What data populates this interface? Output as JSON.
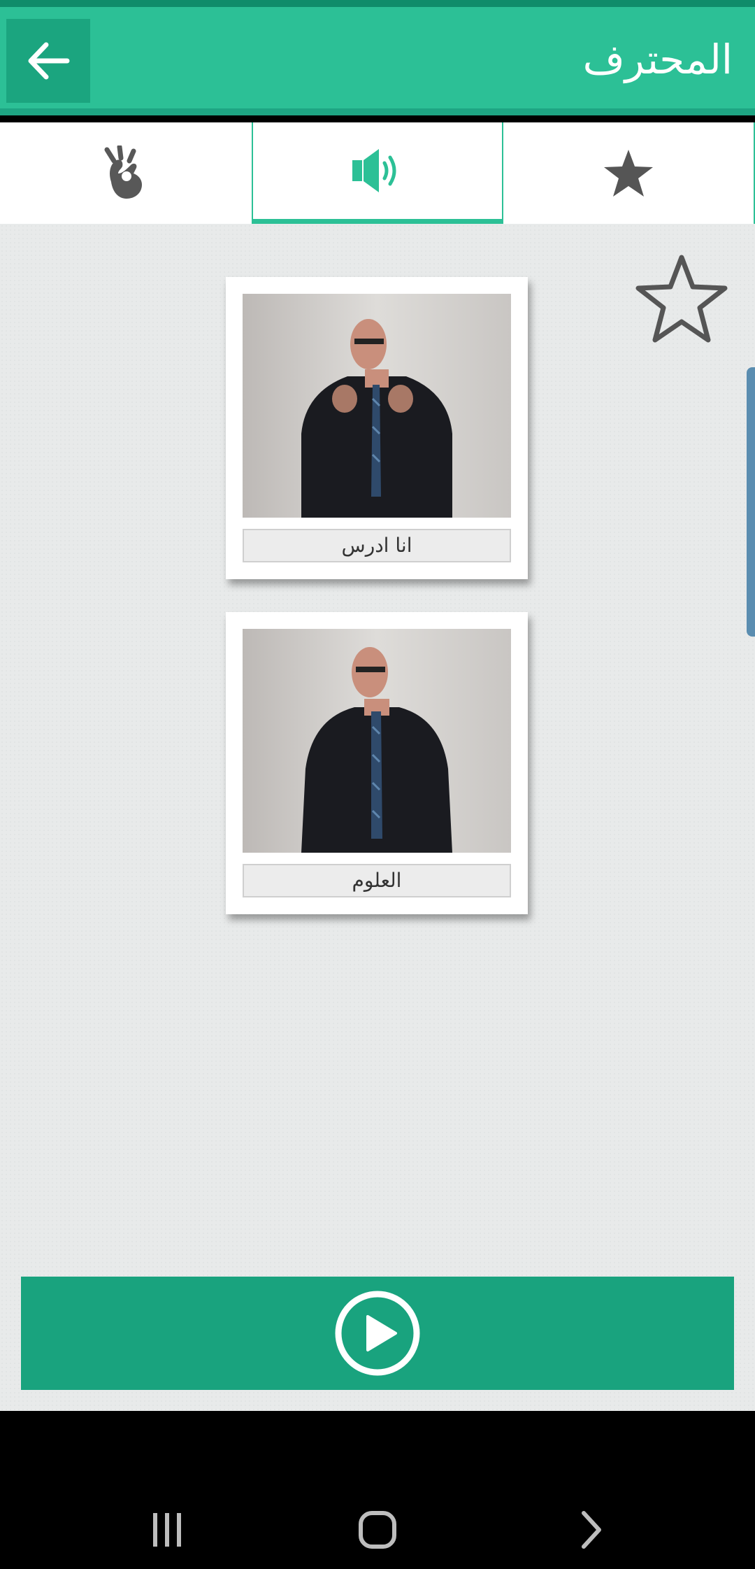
{
  "appbar": {
    "title": "المحترف",
    "back_icon": "arrow-left-icon"
  },
  "tabs": [
    {
      "icon": "hand-sign-icon",
      "selected": false
    },
    {
      "icon": "speaker-icon",
      "selected": true
    },
    {
      "icon": "star-icon",
      "selected": false
    }
  ],
  "favorite": {
    "icon": "star-outline-icon",
    "active": false
  },
  "cards": [
    {
      "caption": "انا ادرس",
      "image": "man-signing-photo"
    },
    {
      "caption": "العلوم",
      "image": "man-signing-photo"
    }
  ],
  "player": {
    "icon": "play-circle-icon"
  },
  "system_nav": {
    "recents_icon": "recents-icon",
    "home_icon": "home-icon",
    "back_icon": "chevron-right-icon"
  },
  "colors": {
    "accent": "#2cc096",
    "accent_dark": "#19a37e",
    "background": "#e8eaea"
  }
}
